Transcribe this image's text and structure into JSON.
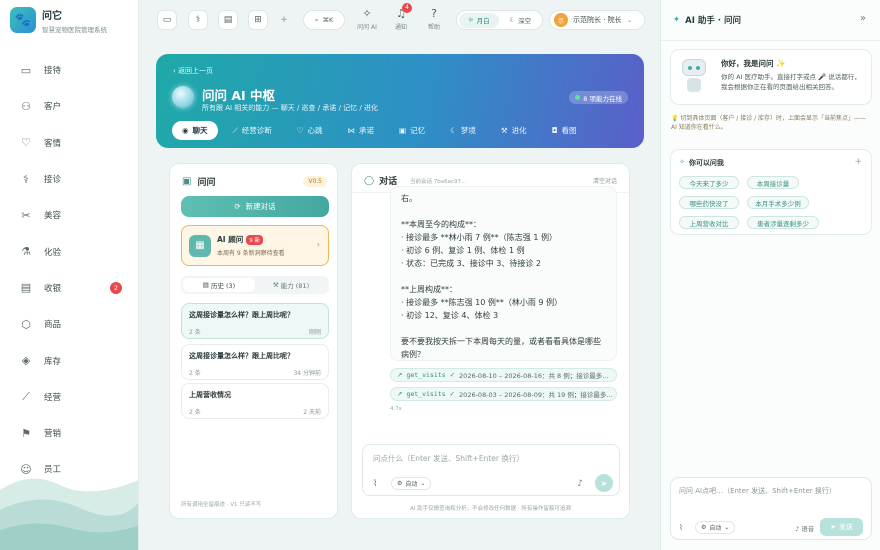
{
  "brand": {
    "name": "问它",
    "subtitle": "智慧宠物医院管理系统",
    "logo_icon": "paw-icon"
  },
  "sidebar": {
    "items": [
      {
        "label": "接待",
        "icon": "reception-icon"
      },
      {
        "label": "客户",
        "icon": "customers-icon"
      },
      {
        "label": "客情",
        "icon": "heart-icon"
      },
      {
        "label": "接诊",
        "icon": "stethoscope-icon"
      },
      {
        "label": "美容",
        "icon": "scissors-icon"
      },
      {
        "label": "化验",
        "icon": "flask-icon"
      },
      {
        "label": "收银",
        "icon": "cashier-icon",
        "badge": "2"
      },
      {
        "label": "商品",
        "icon": "box-icon"
      },
      {
        "label": "库存",
        "icon": "stack-icon"
      },
      {
        "label": "经营",
        "icon": "chart-icon"
      },
      {
        "label": "营销",
        "icon": "flag-icon"
      },
      {
        "label": "员工",
        "icon": "staff-icon"
      }
    ]
  },
  "topbar": {
    "search_hint": "⌘K",
    "ask_ai": "问问 AI",
    "notify": "通知",
    "notify_badge": "4",
    "help": "帮助",
    "theme_light": "月白",
    "theme_dark": "深空",
    "user_name": "示范院长 · 院长",
    "user_avatar": "示"
  },
  "hero": {
    "back": "返回上一页",
    "title": "问问 AI 中枢",
    "subtitle": "所有跟 AI 相关的能力 — 聊天 / 巡查 / 承诺 / 记忆 / 进化",
    "status": "8 项能力在线",
    "tabs": [
      {
        "label": "聊天",
        "icon": "chat-icon"
      },
      {
        "label": "经营诊断",
        "icon": "chart-icon"
      },
      {
        "label": "心跳",
        "icon": "heart-icon"
      },
      {
        "label": "承诺",
        "icon": "handshake-icon"
      },
      {
        "label": "记忆",
        "icon": "memory-icon"
      },
      {
        "label": "梦境",
        "icon": "moon-icon"
      },
      {
        "label": "进化",
        "icon": "wrench-icon"
      },
      {
        "label": "看图",
        "icon": "camera-icon"
      }
    ]
  },
  "left": {
    "title": "问问",
    "version": "V0.5",
    "new_chat": "新建对话",
    "advisor_title": "AI 顾问",
    "advisor_badge": "9 新",
    "advisor_sub": "本周有 9 条新洞察待查看",
    "seg_history": "历史 (3)",
    "seg_skills": "能力 (81)",
    "conversations": [
      {
        "title": "这周接诊量怎么样？跟上周比呢？",
        "count": "2 条",
        "time": "刚刚"
      },
      {
        "title": "这周接诊量怎么样？跟上周比呢？",
        "count": "2 条",
        "time": "34 分钟前"
      },
      {
        "title": "上周营收情况",
        "count": "2 条",
        "time": "2 天前"
      }
    ],
    "footer": "所有调用全留痕迹 · V1 只读不写"
  },
  "chat": {
    "title": "对话",
    "session": "当前会话 7ba6ac97…",
    "clear": "清空对话",
    "message": "右。\n\n**本周至今的构成**：\n· 接诊最多 **林小雨 7 例**（陈志强 1 例）\n· 初诊 6 例、复诊 1 例、体检 1 例\n· 状态：已完成 3、接诊中 3、待接诊 2\n\n**上周构成**：\n· 接诊最多 **陈志强 10 例**（林小雨 9 例）\n· 初诊 12、复诊 4、体检 3\n\n要不要我按天拆一下本周每天的量，或者看看具体是哪些病例？",
    "tools": [
      {
        "name": "get_visits",
        "result": "2026-08-10 – 2026-08-16：共 8 例；接诊最多…"
      },
      {
        "name": "get_visits",
        "result": "2026-08-03 – 2026-08-09：共 19 例；接诊最多…"
      }
    ],
    "duration": "4.7s",
    "input_placeholder": "问点什么（Enter 发送、Shift+Enter 换行）",
    "mode": "自动",
    "footer": "AI 助手仅做查询和分析，不会修改任何数据 · 所有操作留痕可追溯"
  },
  "assistant": {
    "title": "AI 助手 · 问问",
    "greet_title": "你好，我是问问 ✨",
    "greet_body": "你的 AI 医疗助手。直接打字或点 🎤 说话都行，我会根据你正在看的页面给出相关回答。",
    "tip": "💡 切到具体页面（客户 / 接诊 / 库存）时，上面会显示「当前焦点」—— AI 知道你在看什么。",
    "suggest_title": "你可以问我",
    "suggestions": [
      "今天来了多少",
      "本周接诊量",
      "哪些药快没了",
      "本月手术多少例",
      "上周营收对比",
      "患者涉量逐剩多少"
    ],
    "input_placeholder": "问问 AI点吧…（Enter 发送、Shift+Enter 换行）",
    "mode": "自动",
    "voice": "语音",
    "send": "发送"
  }
}
